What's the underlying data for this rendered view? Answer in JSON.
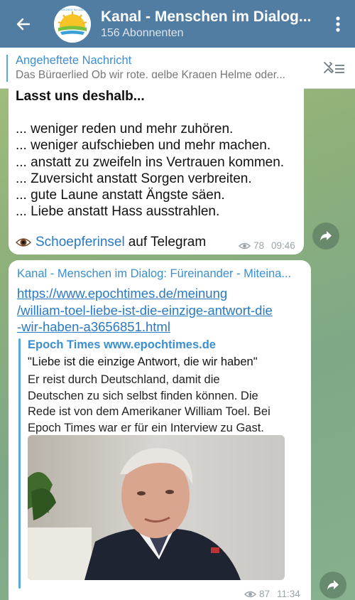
{
  "header": {
    "title": "Kanal - Menschen im Dialog...",
    "subtitle": "156 Abonnenten",
    "avatar_text": "MENSCHEN IM DIALOG",
    "colors": {
      "bar": "#527da3",
      "text": "#ffffff"
    },
    "icons": {
      "back": "arrow-left-icon",
      "menu": "more-vertical-icon"
    }
  },
  "pinned": {
    "title": "Angeheftete Nachricht",
    "text": "Das Bürgerlied Ob wir rote, gelbe Kragen Helme oder...",
    "icon": "unpin-list-icon"
  },
  "message1": {
    "lines": [
      "Lasst uns deshalb...",
      "",
      "... weniger reden und mehr zuhören.",
      "... weniger aufschieben und mehr machen.",
      "... anstatt zu zweifeln ins Vertrauen kommen.",
      "... Zuversicht anstatt Sorgen verbreiten.",
      "... gute Laune anstatt Ängste säen.",
      "... Liebe anstatt Hass ausstrahlen."
    ],
    "signature": {
      "emoji": "eye-emoji",
      "link": "Schoepferinsel",
      "suffix": "auf Telegram"
    },
    "views": "78",
    "time": "09:46"
  },
  "message2": {
    "forward_title": "Kanal - Menschen im Dialog: Füreinander - Miteina...",
    "url_lines": [
      "https://www.epochtimes.de/meinung",
      "/william-toel-liebe-ist-die-einzige-antwort-die",
      "-wir-haben-a3656851.html"
    ],
    "preview": {
      "site": "Epoch Times www.epochtimes.de",
      "title": "\"Liebe ist die einzige Antwort, die wir haben\"",
      "desc_lines": [
        "Er reist durch Deutschland, damit die",
        "Deutschen zu sich selbst finden können. Die",
        "Rede ist von dem Amerikaner William Toel. Bei",
        "Epoch Times war er für ein Interview zu Gast."
      ],
      "image": "photo-elderly-man-interview"
    },
    "views": "87",
    "time": "11:34"
  },
  "accent": "#3b8ed0",
  "link_color": "#2a79c3"
}
